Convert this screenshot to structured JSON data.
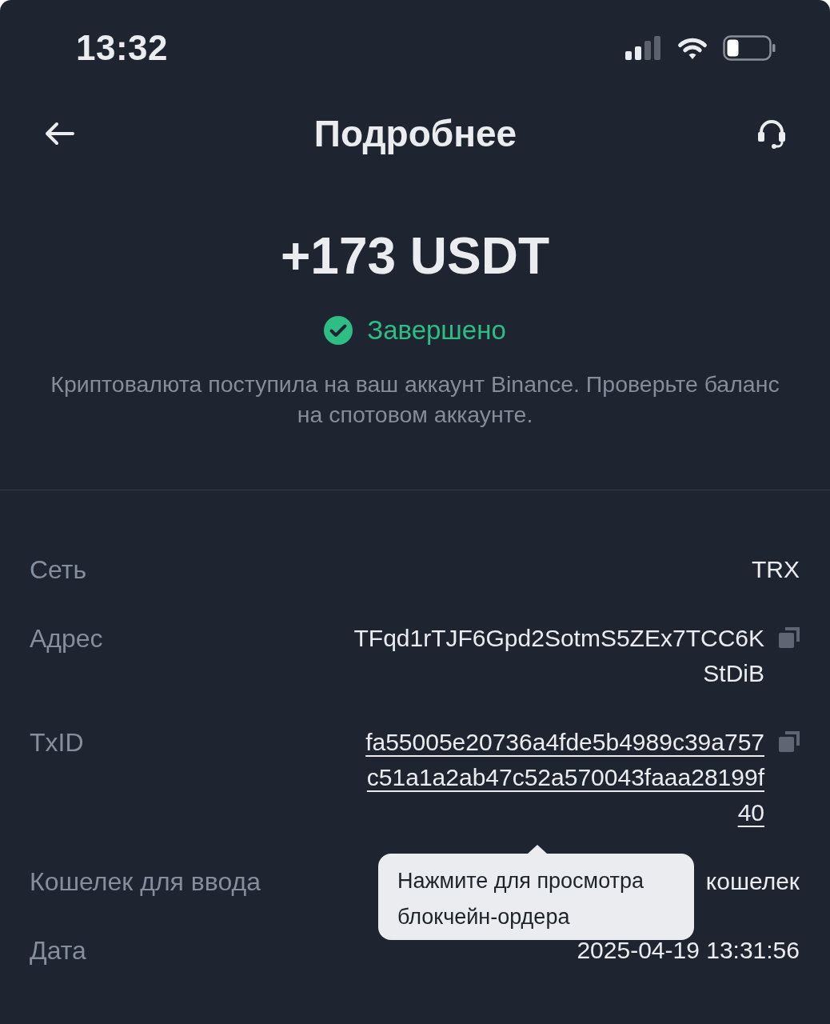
{
  "status_bar": {
    "time": "13:32"
  },
  "header": {
    "title": "Подробнее"
  },
  "summary": {
    "amount": "+173 USDT",
    "status": {
      "label": "Завершено",
      "kind": "success"
    },
    "description": "Криптовалюта поступила на ваш аккаунт Binance. Проверьте баланс на спотовом аккаунте."
  },
  "details": [
    {
      "label": "Сеть",
      "value": "TRX",
      "kind": "text",
      "copyable": false
    },
    {
      "label": "Адрес",
      "value": "TFqd1rTJF6Gpd2SotmS5ZEx7TCC6KStDiB",
      "kind": "text",
      "copyable": true
    },
    {
      "label": "TxID",
      "value": "fa55005e20736a4fde5b4989c39a757c51a1a2ab47c52a570043faaa28199f40",
      "kind": "link",
      "copyable": true
    },
    {
      "label": "Кошелек для ввода",
      "value": "кошелек",
      "kind": "text",
      "copyable": false
    },
    {
      "label": "Дата",
      "value": "2025-04-19 13:31:56",
      "kind": "text",
      "copyable": false
    }
  ],
  "tooltip": {
    "text": "Нажмите для просмотра блокчейн-ордера"
  }
}
